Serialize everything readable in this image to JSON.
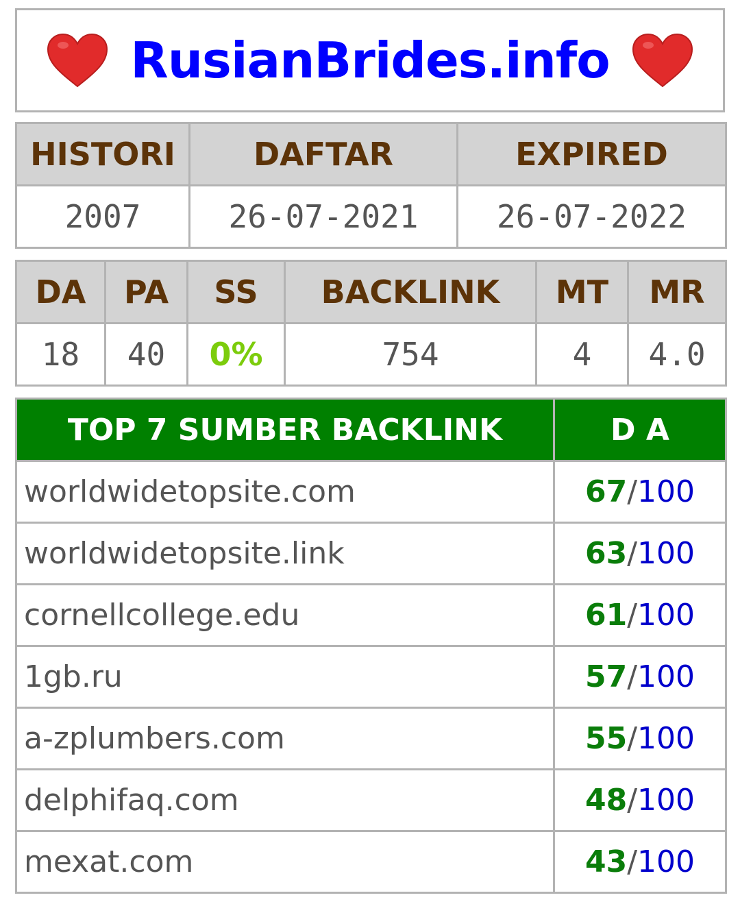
{
  "title": {
    "text": "RusianBrides.info",
    "icon_left": "heart-icon",
    "icon_right": "heart-icon",
    "colors": {
      "title": "#0000ff",
      "heart": "#e12b2b"
    }
  },
  "dates": {
    "headers": [
      "HISTORI",
      "DAFTAR",
      "EXPIRED"
    ],
    "values": [
      "2007",
      "26-07-2021",
      "26-07-2022"
    ]
  },
  "metrics": {
    "headers": [
      "DA",
      "PA",
      "SS",
      "BACKLINK",
      "MT",
      "MR"
    ],
    "values": [
      "18",
      "40",
      "0%",
      "754",
      "4",
      "4.0"
    ]
  },
  "backlinks": {
    "header_source": "TOP 7 SUMBER BACKLINK",
    "header_da": "D A",
    "separator": "/",
    "max": "100",
    "rows": [
      {
        "site": "worldwidetopsite.com",
        "da": "67"
      },
      {
        "site": "worldwidetopsite.link",
        "da": "63"
      },
      {
        "site": "cornellcollege.edu",
        "da": "61"
      },
      {
        "site": "1gb.ru",
        "da": "57"
      },
      {
        "site": "a-zplumbers.com",
        "da": "55"
      },
      {
        "site": "delphifaq.com",
        "da": "48"
      },
      {
        "site": "mexat.com",
        "da": "43"
      }
    ],
    "colors": {
      "header_bg": "#008000",
      "score": "#0a7d0a",
      "max": "#0000cc"
    }
  }
}
